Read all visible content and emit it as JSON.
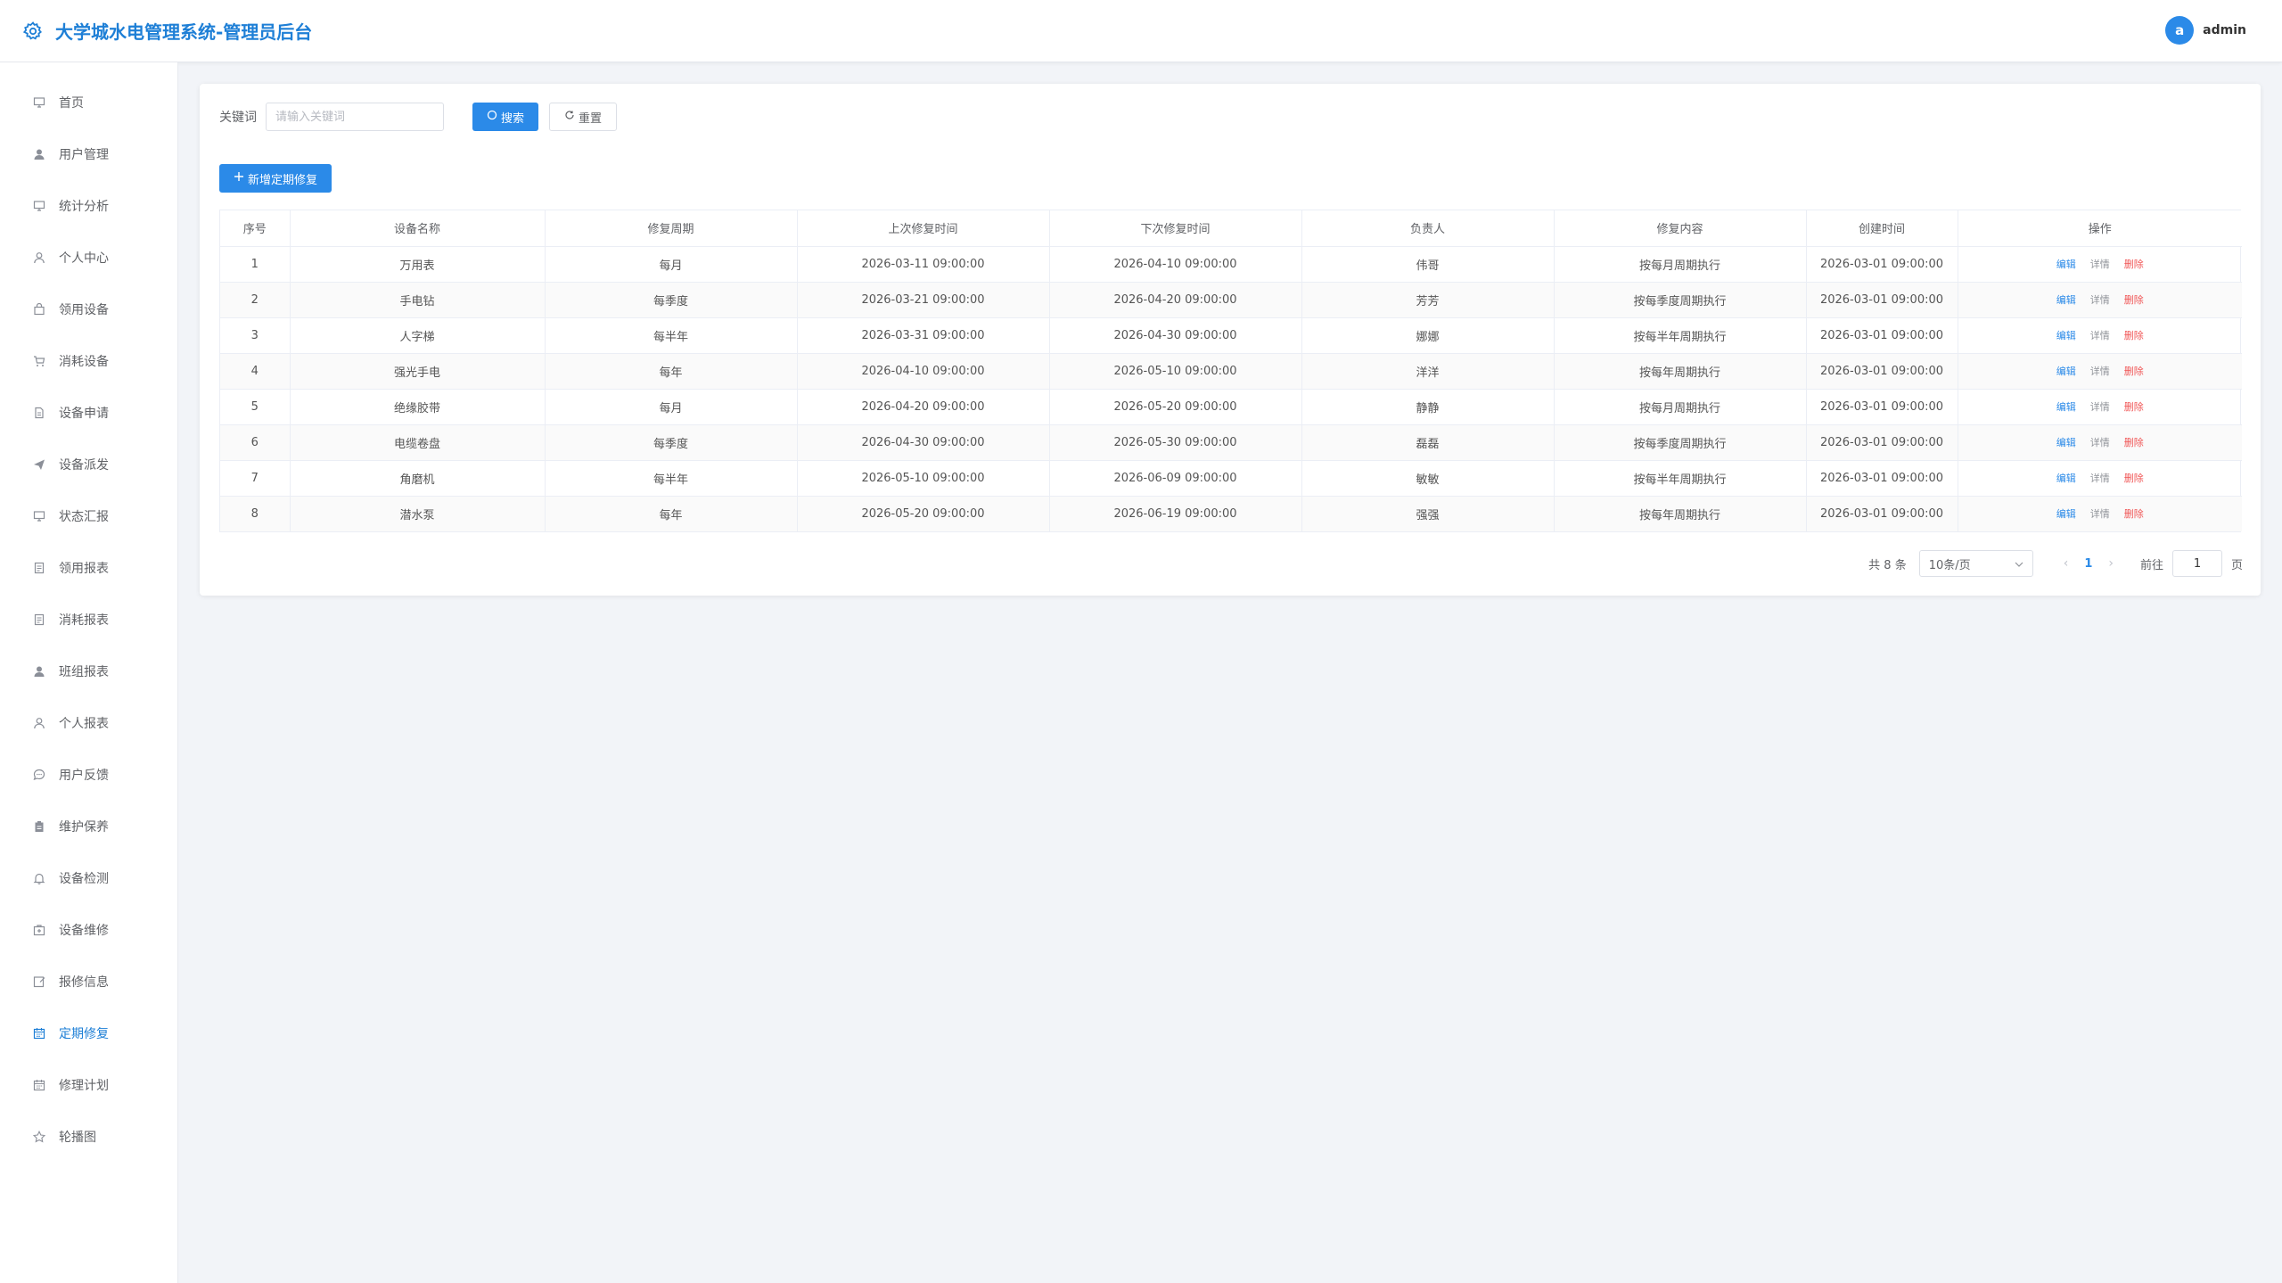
{
  "header": {
    "title": "大学城水电管理系统-管理员后台",
    "avatar_letter": "a",
    "username": "admin"
  },
  "sidebar": {
    "items": [
      {
        "label": "首页",
        "icon": "monitor-icon"
      },
      {
        "label": "用户管理",
        "icon": "user-icon"
      },
      {
        "label": "统计分析",
        "icon": "monitor-icon"
      },
      {
        "label": "个人中心",
        "icon": "user-outline-icon"
      },
      {
        "label": "领用设备",
        "icon": "bag-icon"
      },
      {
        "label": "消耗设备",
        "icon": "cart-icon"
      },
      {
        "label": "设备申请",
        "icon": "document-icon"
      },
      {
        "label": "设备派发",
        "icon": "send-icon"
      },
      {
        "label": "状态汇报",
        "icon": "monitor-icon"
      },
      {
        "label": "领用报表",
        "icon": "report-icon"
      },
      {
        "label": "消耗报表",
        "icon": "report-icon"
      },
      {
        "label": "班组报表",
        "icon": "user-icon"
      },
      {
        "label": "个人报表",
        "icon": "user-outline-icon"
      },
      {
        "label": "用户反馈",
        "icon": "chat-icon"
      },
      {
        "label": "维护保养",
        "icon": "clipboard-icon"
      },
      {
        "label": "设备检测",
        "icon": "bell-icon"
      },
      {
        "label": "设备维修",
        "icon": "toolbox-icon"
      },
      {
        "label": "报修信息",
        "icon": "edit-icon"
      },
      {
        "label": "定期修复",
        "icon": "calendar-icon",
        "active": true
      },
      {
        "label": "修理计划",
        "icon": "calendar-icon"
      },
      {
        "label": "轮播图",
        "icon": "star-icon"
      }
    ]
  },
  "search": {
    "label": "关键词",
    "placeholder": "请输入关键词",
    "value": "",
    "search_btn": "搜索",
    "reset_btn": "重置"
  },
  "add_btn": "新增定期修复",
  "table": {
    "columns": [
      "序号",
      "设备名称",
      "修复周期",
      "上次修复时间",
      "下次修复时间",
      "负责人",
      "修复内容",
      "创建时间",
      "操作"
    ],
    "rows": [
      [
        "1",
        "万用表",
        "每月",
        "2026-03-11 09:00:00",
        "2026-04-10 09:00:00",
        "伟哥",
        "按每月周期执行",
        "2026-03-01 09:00:00"
      ],
      [
        "2",
        "手电钻",
        "每季度",
        "2026-03-21 09:00:00",
        "2026-04-20 09:00:00",
        "芳芳",
        "按每季度周期执行",
        "2026-03-01 09:00:00"
      ],
      [
        "3",
        "人字梯",
        "每半年",
        "2026-03-31 09:00:00",
        "2026-04-30 09:00:00",
        "娜娜",
        "按每半年周期执行",
        "2026-03-01 09:00:00"
      ],
      [
        "4",
        "强光手电",
        "每年",
        "2026-04-10 09:00:00",
        "2026-05-10 09:00:00",
        "洋洋",
        "按每年周期执行",
        "2026-03-01 09:00:00"
      ],
      [
        "5",
        "绝缘胶带",
        "每月",
        "2026-04-20 09:00:00",
        "2026-05-20 09:00:00",
        "静静",
        "按每月周期执行",
        "2026-03-01 09:00:00"
      ],
      [
        "6",
        "电缆卷盘",
        "每季度",
        "2026-04-30 09:00:00",
        "2026-05-30 09:00:00",
        "磊磊",
        "按每季度周期执行",
        "2026-03-01 09:00:00"
      ],
      [
        "7",
        "角磨机",
        "每半年",
        "2026-05-10 09:00:00",
        "2026-06-09 09:00:00",
        "敏敏",
        "按每半年周期执行",
        "2026-03-01 09:00:00"
      ],
      [
        "8",
        "潜水泵",
        "每年",
        "2026-05-20 09:00:00",
        "2026-06-19 09:00:00",
        "强强",
        "按每年周期执行",
        "2026-03-01 09:00:00"
      ]
    ],
    "actions": {
      "edit": "编辑",
      "detail": "详情",
      "delete": "删除"
    }
  },
  "pagination": {
    "total_text": "共 8 条",
    "page_size": "10条/页",
    "current_page": "1",
    "goto_label": "前往",
    "goto_value": "1",
    "page_suffix": "页"
  },
  "colors": {
    "primary": "#2b8ae8",
    "title": "#1e7fd6",
    "danger": "#f05656"
  }
}
